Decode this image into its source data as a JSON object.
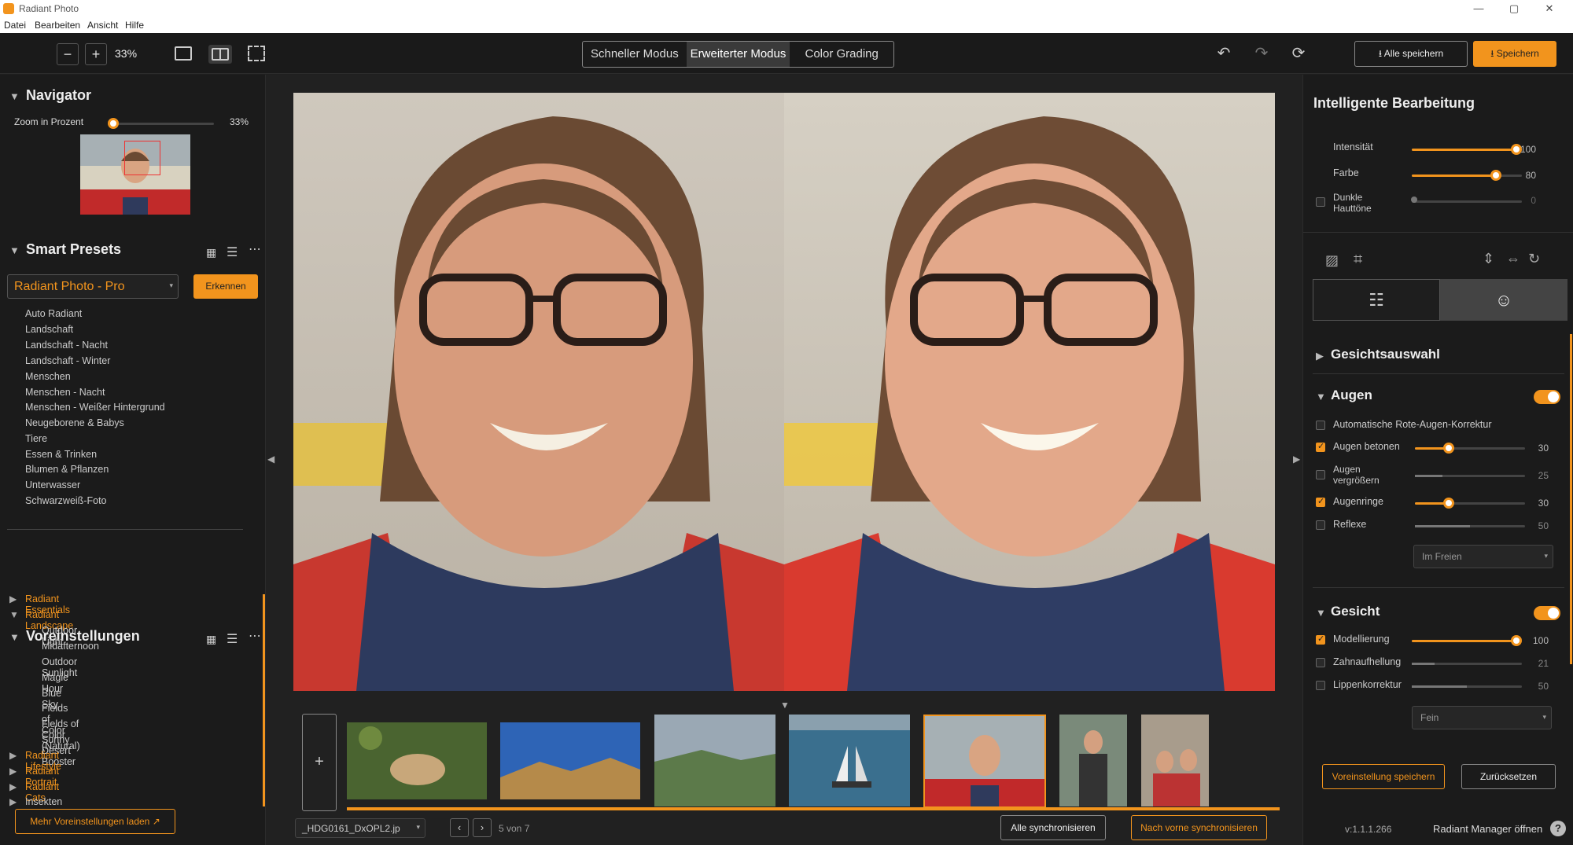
{
  "window": {
    "title": "Radiant Photo",
    "min": "—",
    "max": "▢",
    "close": "✕"
  },
  "menu": [
    "Datei",
    "Bearbeiten",
    "Ansicht",
    "Hilfe"
  ],
  "toolbar": {
    "zoom_minus": "−",
    "zoom_plus": "+",
    "zoom_value": "33%",
    "modes": [
      "Schneller Modus",
      "Erweiterter Modus",
      "Color Grading"
    ],
    "active_mode": 1,
    "save_all": "Alle speichern",
    "save": "Speichern",
    "undo": "↶",
    "redo": "↷",
    "reset": "⟳"
  },
  "navigator": {
    "title": "Navigator",
    "zoom_label": "Zoom in Prozent",
    "zoom_value": "33%",
    "zoom_level": 0.33
  },
  "smart_presets": {
    "title": "Smart Presets",
    "selected": "Radiant Photo - Pro",
    "detect": "Erkennen",
    "items": [
      "Auto Radiant",
      "Landschaft",
      "Landschaft - Nacht",
      "Landschaft - Winter",
      "Menschen",
      "Menschen - Nacht",
      "Menschen - Weißer Hintergrund",
      "Neugeborene & Babys",
      "Tiere",
      "Essen & Trinken",
      "Blumen & Pflanzen",
      "Unterwasser",
      "Schwarzweiß-Foto"
    ]
  },
  "presets": {
    "title": "Voreinstellungen",
    "groups": [
      {
        "label": "Radiant Essentials",
        "open": false
      },
      {
        "label": "Radiant Landscape",
        "open": true,
        "children": [
          "Outdoor Light",
          "Midafternoon",
          "Outdoor Sunlight",
          "Magic Hour",
          "Blue Sky",
          "Fields of Color",
          "Fields of Color (Natural)",
          "Sunny Desert Booster"
        ]
      },
      {
        "label": "Radiant Lifestyle",
        "open": false
      },
      {
        "label": "Radiant Portrait",
        "open": false
      },
      {
        "label": "Radiant Cats",
        "open": false
      },
      {
        "label": "Insekten",
        "open": false
      }
    ],
    "more": "Mehr Voreinstellungen laden"
  },
  "filmstrip": {
    "add": "+",
    "filename": "_HDG0161_DxOPL2.jp",
    "counter": "5 von 7",
    "sync_all": "Alle synchronisieren",
    "sync_forward": "Nach vorne synchronisieren"
  },
  "right": {
    "title": "Intelligente Bearbeitung",
    "sliders": [
      {
        "label": "Intensität",
        "value": 100,
        "max": 100
      },
      {
        "label": "Farbe",
        "value": 80,
        "max": 100
      },
      {
        "label": "Dunkle Hauttöne",
        "value": 0,
        "max": 100,
        "disabled": true
      }
    ],
    "face_select": "Gesichtsauswahl",
    "eyes": {
      "title": "Augen",
      "items": [
        {
          "label": "Automatische Rote-Augen-Korrektur",
          "checked": false
        },
        {
          "label": "Augen betonen",
          "checked": true,
          "value": 30
        },
        {
          "label": "Augen vergrößern",
          "checked": false,
          "value": 25
        },
        {
          "label": "Augenringe",
          "checked": true,
          "value": 30
        },
        {
          "label": "Reflexe",
          "checked": false,
          "value": 50
        }
      ],
      "dropdown": "Im Freien"
    },
    "face": {
      "title": "Gesicht",
      "items": [
        {
          "label": "Modellierung",
          "checked": true,
          "value": 100
        },
        {
          "label": "Zahnaufhellung",
          "checked": false,
          "value": 21
        },
        {
          "label": "Lippenkorrektur",
          "checked": false,
          "value": 50
        }
      ],
      "dropdown": "Fein"
    },
    "save_preset": "Voreinstellung speichern",
    "reset": "Zurücksetzen",
    "version": "v:1.1.1.266",
    "manager": "Radiant Manager öffnen",
    "help": "?"
  },
  "colors": {
    "accent": "#f2941d",
    "bg": "#1b1b1b"
  }
}
